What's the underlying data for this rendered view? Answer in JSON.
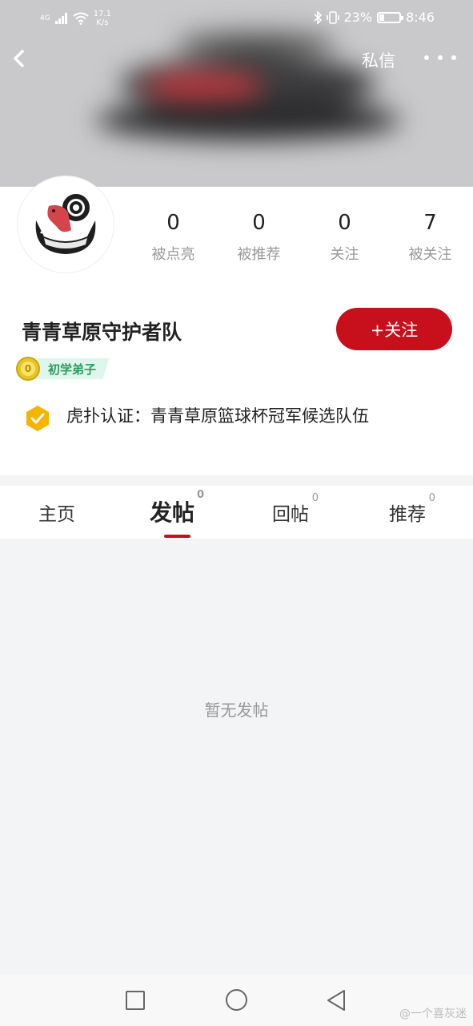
{
  "status_bar": {
    "signal": "4G",
    "speed_value": "17.1",
    "speed_unit": "K/s",
    "battery": "23%",
    "battery_level": 0.23,
    "time": "8:46"
  },
  "header": {
    "dm_label": "私信"
  },
  "stats": [
    {
      "value": "0",
      "label": "被点亮"
    },
    {
      "value": "0",
      "label": "被推荐"
    },
    {
      "value": "0",
      "label": "关注"
    },
    {
      "value": "7",
      "label": "被关注"
    }
  ],
  "profile": {
    "name": "青青草原守护者队",
    "follow_label": "+关注",
    "level_number": "0",
    "level_name": "初学弟子",
    "cert_text": "虎扑认证：青青草原篮球杯冠军候选队伍"
  },
  "tabs": [
    {
      "label": "主页",
      "count": ""
    },
    {
      "label": "发帖",
      "count": "0"
    },
    {
      "label": "回帖",
      "count": "0"
    },
    {
      "label": "推荐",
      "count": "0"
    }
  ],
  "active_tab": "发帖",
  "empty_message": "暂无发帖",
  "watermark": "@一个喜灰迷",
  "colors": {
    "accent": "#c8101c",
    "level_tag_bg": "#dff6ec",
    "level_tag_text": "#2a9a5e",
    "cert_badge": "#f4b400"
  }
}
